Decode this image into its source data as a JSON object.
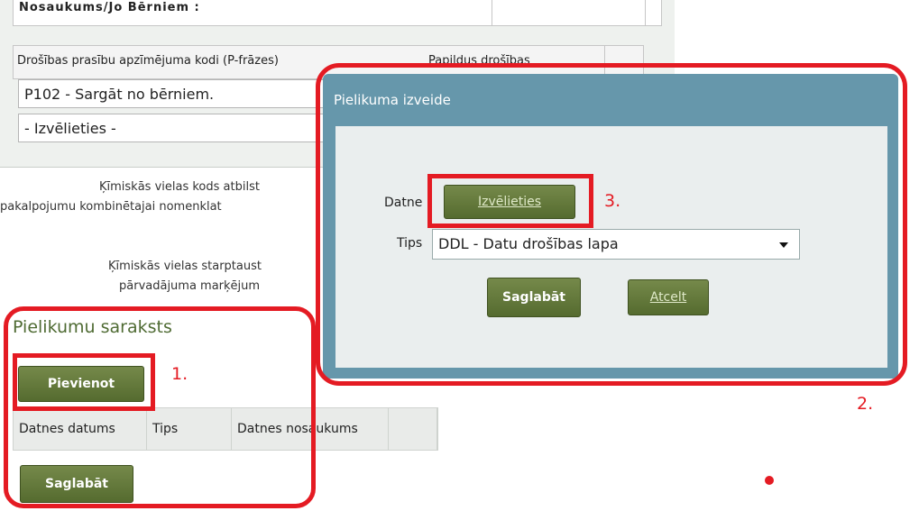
{
  "form": {
    "top_row_text": "Nosaukums/Jo Bērniem :",
    "header_col1": "Drošības prasību apzīmējuma kodi (P-frāzes)",
    "header_col2": "Papildus drošības",
    "select1_value": "P102 - Sargāt no bērniem.",
    "select2_value": "- Izvēlieties -",
    "info1_line1": "Ķīmiskās vielas kods atbilst",
    "info1_line2": "pakalpojumu kombinētajai nomenklat",
    "info2_line1": "Ķīmiskās vielas starptaust",
    "info2_line2": "pārvadājuma marķējum"
  },
  "attachments": {
    "title": "Pielikumu saraksts",
    "add_button": "Pievienot",
    "columns": [
      "Datnes datums",
      "Tips",
      "Datnes nosaukums",
      ""
    ],
    "save_button": "Saglabāt"
  },
  "dialog": {
    "title": "Pielikuma izveide",
    "file_label": "Datne",
    "choose_button": "Izvēlieties",
    "type_label": "Tips",
    "type_value": "DDL - Datu drošības lapa",
    "save_button": "Saglabāt",
    "cancel_button": "Atcelt"
  },
  "annotations": {
    "label1": "1.",
    "label2": "2.",
    "label3": "3.",
    "color": "#e41b23"
  }
}
